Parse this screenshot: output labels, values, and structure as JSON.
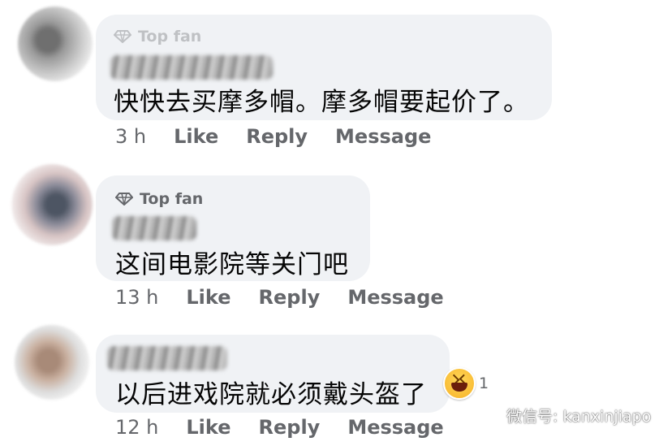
{
  "badge_label": "Top fan",
  "comments": [
    {
      "badge": "Top fan",
      "text": "快快去买摩多帽。摩多帽要起价了。",
      "time": "3 h",
      "like": "Like",
      "reply": "Reply",
      "message": "Message"
    },
    {
      "badge": "Top fan",
      "text": "这间电影院等关门吧",
      "time": "13 h",
      "like": "Like",
      "reply": "Reply",
      "message": "Message"
    },
    {
      "text": "以后进戏院就必须戴头盔了",
      "time": "12 h",
      "like": "Like",
      "reply": "Reply",
      "message": "Message",
      "reaction": {
        "icon": "laugh-emoji-icon",
        "count": "1"
      }
    }
  ],
  "watermark": {
    "text": "微信号: kanxinjiapo",
    "icon": "wechat-icon"
  }
}
